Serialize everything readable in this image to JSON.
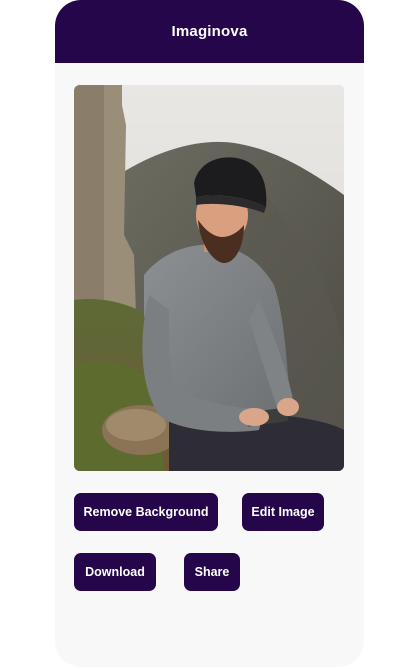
{
  "app": {
    "title": "Imaginova"
  },
  "preview_image": {
    "subject": "man in grey sweater and black beanie sitting on a rock holding a phone, mountain background"
  },
  "actions": {
    "remove_background_label": "Remove Background",
    "edit_image_label": "Edit Image",
    "download_label": "Download",
    "share_label": "Share"
  },
  "colors": {
    "brand": "#26064a",
    "surface": "#f8f8f8",
    "button_text": "#ffffff"
  }
}
